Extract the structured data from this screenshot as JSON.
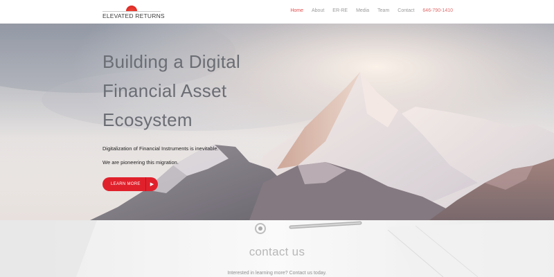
{
  "header": {
    "logo_text": "ELEVATED RETURNS",
    "nav": [
      {
        "label": "Home",
        "active": true
      },
      {
        "label": "About",
        "active": false
      },
      {
        "label": "ER-RE",
        "active": false
      },
      {
        "label": "Media",
        "active": false
      },
      {
        "label": "Team",
        "active": false
      },
      {
        "label": "Contact",
        "active": false
      }
    ],
    "phone": "646-790-1410"
  },
  "hero": {
    "title_line1": "Building a Digital",
    "title_line2": "Financial Asset",
    "title_line3": "Ecosystem",
    "text1": "Digitalization of Financial Instruments is inevitable.",
    "text2": "We are pioneering this migration.",
    "cta_label": "LEARN MORE",
    "cta_icon": "play-arrow-icon"
  },
  "contact": {
    "title": "contact us",
    "subtitle": "Interested in learning more? Contact us today."
  },
  "colors": {
    "accent": "#e0212c",
    "nav_active": "#e44b4b",
    "nav_text": "#9a9a9a"
  }
}
